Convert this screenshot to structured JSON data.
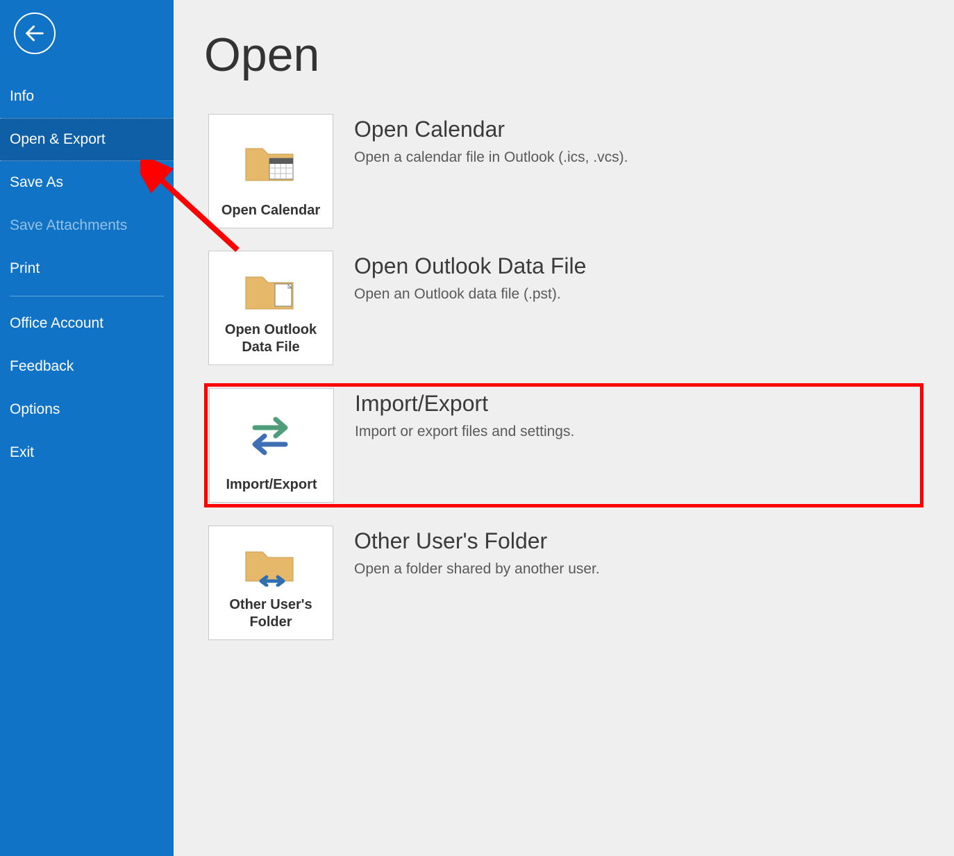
{
  "sidebar": {
    "items": [
      {
        "label": "Info",
        "active": false,
        "disabled": false
      },
      {
        "label": "Open & Export",
        "active": true,
        "disabled": false
      },
      {
        "label": "Save As",
        "active": false,
        "disabled": false
      },
      {
        "label": "Save Attachments",
        "active": false,
        "disabled": true
      },
      {
        "label": "Print",
        "active": false,
        "disabled": false
      }
    ],
    "bottom_items": [
      {
        "label": "Office Account"
      },
      {
        "label": "Feedback"
      },
      {
        "label": "Options"
      },
      {
        "label": "Exit"
      }
    ]
  },
  "page": {
    "title": "Open"
  },
  "actions": [
    {
      "tile_label": "Open Calendar",
      "title": "Open Calendar",
      "text": "Open a calendar file in Outlook (.ics, .vcs).",
      "highlight": false,
      "icon": "calendar"
    },
    {
      "tile_label": "Open Outlook Data File",
      "title": "Open Outlook Data File",
      "text": "Open an Outlook data file (.pst).",
      "highlight": false,
      "icon": "datafile"
    },
    {
      "tile_label": "Import/Export",
      "title": "Import/Export",
      "text": "Import or export files and settings.",
      "highlight": true,
      "icon": "importexport"
    },
    {
      "tile_label": "Other User's Folder",
      "title": "Other User's Folder",
      "text": "Open a folder shared by another user.",
      "highlight": false,
      "icon": "sharedfolder"
    }
  ]
}
